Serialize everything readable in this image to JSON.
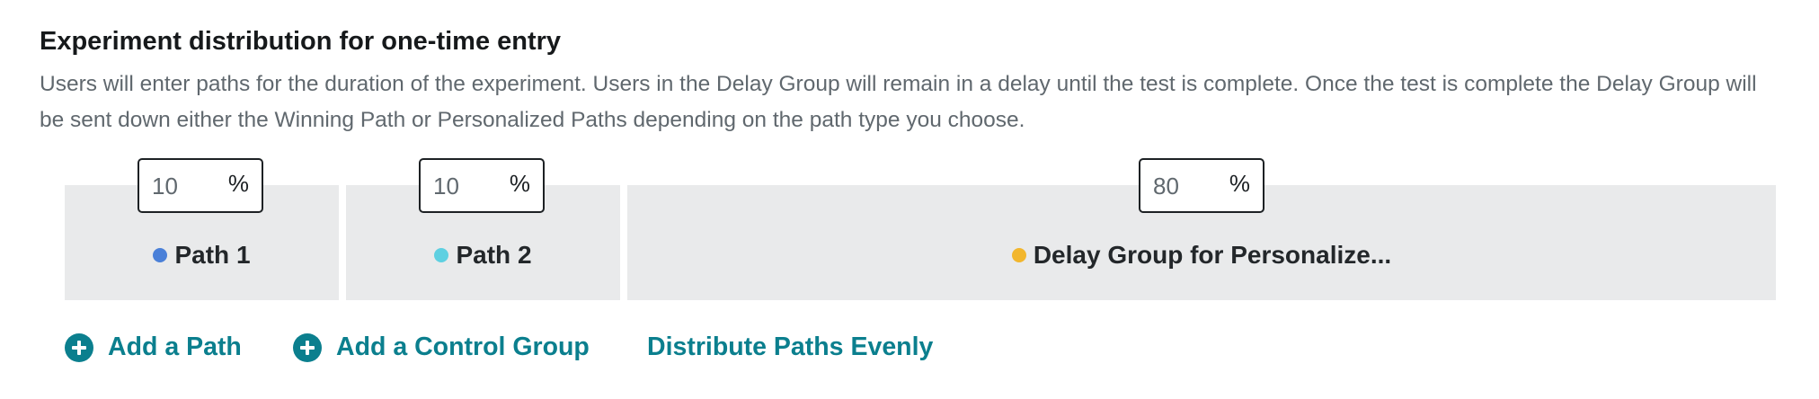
{
  "section": {
    "title": "Experiment distribution for one-time entry",
    "description": "Users will enter paths for the duration of the experiment. Users in the Delay Group will remain in a delay until the test is complete. Once the test is complete the Delay Group will be sent down either the Winning Path or Personalized Paths depending on the path type you choose."
  },
  "distribution": {
    "percent_symbol": "%",
    "segments": [
      {
        "label": "Path 1",
        "percent": "10",
        "dot_color": "#4a80d8",
        "dot_icon": "circle-dot-icon"
      },
      {
        "label": "Path 2",
        "percent": "10",
        "dot_color": "#5ed0e1",
        "dot_icon": "circle-dot-icon"
      },
      {
        "label": "Delay Group for Personalize...",
        "percent": "80",
        "dot_color": "#f2b62d",
        "dot_icon": "circle-dot-icon"
      }
    ]
  },
  "actions": {
    "add_path": "Add a Path",
    "add_control_group": "Add a Control Group",
    "distribute_evenly": "Distribute Paths Evenly",
    "plus_icon": "plus-circle-icon",
    "accent_color": "#0b7f8e"
  }
}
